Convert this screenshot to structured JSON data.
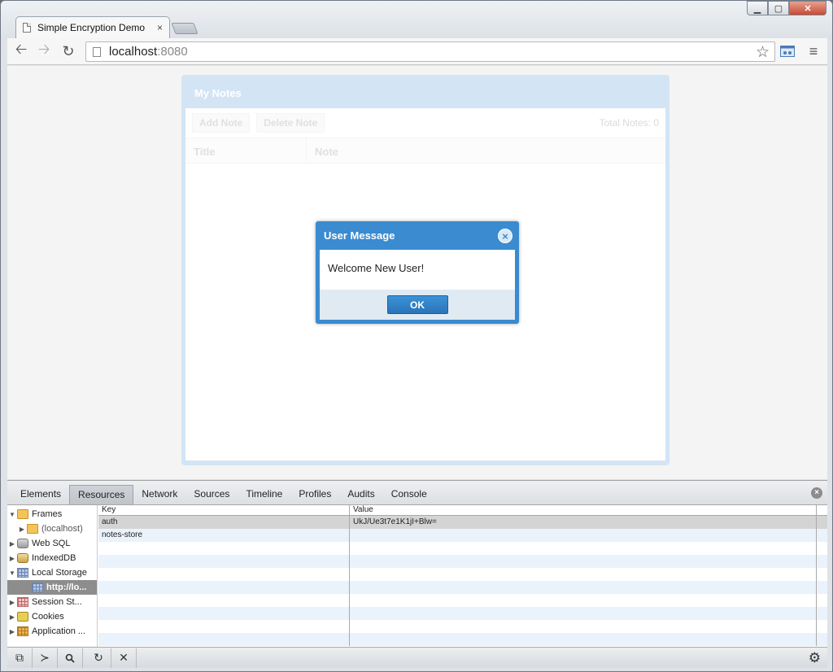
{
  "browser": {
    "tab_title": "Simple Encryption Demo",
    "tab_close": "×",
    "url_host": "localhost",
    "url_port": ":8080"
  },
  "window": {
    "minimize": "▁",
    "maximize": "▢",
    "close": "✕"
  },
  "page": {
    "panel_title": "My Notes",
    "add_note": "Add Note",
    "delete_note": "Delete Note",
    "total_notes": "Total Notes: 0",
    "col_title": "Title",
    "col_note": "Note"
  },
  "dialog": {
    "title": "User Message",
    "message": "Welcome New User!",
    "ok": "OK"
  },
  "devtools": {
    "tabs": [
      "Elements",
      "Resources",
      "Network",
      "Sources",
      "Timeline",
      "Profiles",
      "Audits",
      "Console"
    ],
    "sidebar": {
      "frames": "Frames",
      "localhost": "(localhost)",
      "web_sql": "Web SQL",
      "indexeddb": "IndexedDB",
      "local_storage": "Local Storage",
      "local_storage_origin": "http://lo...",
      "session_storage": "Session St...",
      "cookies": "Cookies",
      "app_cache": "Application ..."
    },
    "table": {
      "col_key": "Key",
      "col_value": "Value",
      "rows": [
        {
          "key": "auth",
          "value": "UkJ/Ue3t7e1K1jI+Blw="
        },
        {
          "key": "notes-store",
          "value": ""
        }
      ]
    }
  },
  "colors": {
    "dialog_blue": "#3a8bd0",
    "panel_blue": "#bcd8ee"
  }
}
